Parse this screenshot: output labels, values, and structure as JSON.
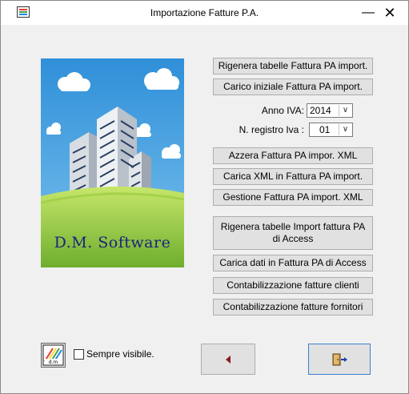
{
  "window": {
    "title": "Importazione Fatture P.A.",
    "minimize_glyph": "—",
    "close_glyph": "✕"
  },
  "logo": {
    "text": "D.M. Software"
  },
  "buttons": {
    "rigenera_tabelle": "Rigenera tabelle Fattura PA import.",
    "carico_iniziale": "Carico iniziale Fattura PA import.",
    "azzera": "Azzera Fattura PA impor. XML",
    "carica_xml": "Carica XML in Fattura PA import.",
    "gestione": "Gestione Fattura PA import. XML",
    "rigenera_access": "Rigenera tabelle Import fattura PA di Access",
    "carica_access": "Carica dati in Fattura PA di Access",
    "contab_clienti": "Contabilizzazione fatture clienti",
    "contab_fornitori": "Contabilizzazione fatture fornitori"
  },
  "fields": {
    "anno_iva_label": "Anno IVA:",
    "anno_iva_value": "2014",
    "registro_label": "N. registro Iva :",
    "registro_value": "01"
  },
  "checkbox": {
    "sempre_visibile": "Sempre visibile.",
    "checked": false
  },
  "icons": {
    "back": "triangle-left-icon",
    "exit": "exit-door-icon",
    "dropdown": "chevron-down-icon",
    "app": "app-logo-icon"
  },
  "colors": {
    "sky": "#3399dd",
    "grass": "#8bc34a",
    "logo_text": "#1a237e",
    "back_arrow": "#8b1a1a"
  }
}
